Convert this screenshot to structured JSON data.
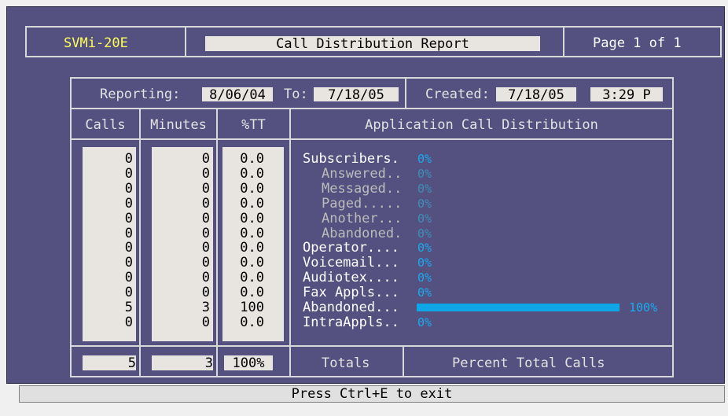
{
  "header": {
    "app_name": "SVMi-20E",
    "report_title": "Call Distribution Report",
    "page_label": "Page 1 of 1"
  },
  "reporting": {
    "label": "Reporting:",
    "from_date": "8/06/04",
    "to_label": "To:",
    "to_date": "7/18/05",
    "created_label": "Created:",
    "created_date": "7/18/05",
    "created_time": "3:29 P"
  },
  "columns": {
    "calls": "Calls",
    "minutes": "Minutes",
    "pct": "%TT",
    "distribution": "Application Call Distribution"
  },
  "rows": [
    {
      "label": "Subscribers.",
      "indent": false,
      "calls": "0",
      "minutes": "0",
      "pct": "0.0",
      "bar_pct": "0%",
      "bar_fraction": 0
    },
    {
      "label": "Answered..",
      "indent": true,
      "calls": "0",
      "minutes": "0",
      "pct": "0.0",
      "bar_pct": "0%",
      "bar_fraction": 0
    },
    {
      "label": "Messaged..",
      "indent": true,
      "calls": "0",
      "minutes": "0",
      "pct": "0.0",
      "bar_pct": "0%",
      "bar_fraction": 0
    },
    {
      "label": "Paged.....",
      "indent": true,
      "calls": "0",
      "minutes": "0",
      "pct": "0.0",
      "bar_pct": "0%",
      "bar_fraction": 0
    },
    {
      "label": "Another...",
      "indent": true,
      "calls": "0",
      "minutes": "0",
      "pct": "0.0",
      "bar_pct": "0%",
      "bar_fraction": 0
    },
    {
      "label": "Abandoned.",
      "indent": true,
      "calls": "0",
      "minutes": "0",
      "pct": "0.0",
      "bar_pct": "0%",
      "bar_fraction": 0
    },
    {
      "label": "Operator....",
      "indent": false,
      "calls": "0",
      "minutes": "0",
      "pct": "0.0",
      "bar_pct": "0%",
      "bar_fraction": 0
    },
    {
      "label": "Voicemail...",
      "indent": false,
      "calls": "0",
      "minutes": "0",
      "pct": "0.0",
      "bar_pct": "0%",
      "bar_fraction": 0
    },
    {
      "label": "Audiotex....",
      "indent": false,
      "calls": "0",
      "minutes": "0",
      "pct": "0.0",
      "bar_pct": "0%",
      "bar_fraction": 0
    },
    {
      "label": "Fax Appls...",
      "indent": false,
      "calls": "0",
      "minutes": "0",
      "pct": "0.0",
      "bar_pct": "0%",
      "bar_fraction": 0
    },
    {
      "label": "Abandoned...",
      "indent": false,
      "calls": "5",
      "minutes": "3",
      "pct": "100",
      "bar_pct": "100%",
      "bar_fraction": 1
    },
    {
      "label": "IntraAppls..",
      "indent": false,
      "calls": "0",
      "minutes": "0",
      "pct": "0.0",
      "bar_pct": "0%",
      "bar_fraction": 0
    }
  ],
  "totals": {
    "calls": "5",
    "minutes": "3",
    "pct": "100%",
    "label": "Totals",
    "percent_label": "Percent Total Calls"
  },
  "status_bar": "Press Ctrl+E to exit",
  "colors": {
    "background": "#54507f",
    "bar": "#0fa6e8",
    "highlight": "#ffff55",
    "field": "#e8e4e0"
  }
}
